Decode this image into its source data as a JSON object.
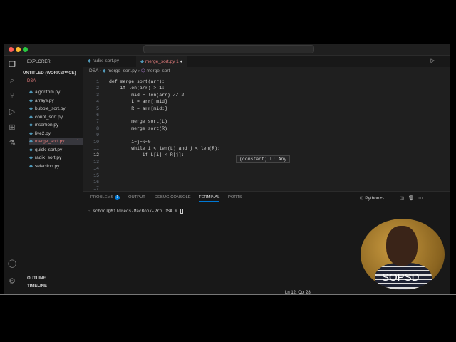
{
  "explorer": {
    "title": "EXPLORER",
    "workspace": "UNTITLED (WORKSPACE)",
    "folder": "DSA",
    "files": [
      {
        "name": "algorithm.py"
      },
      {
        "name": "arrays.py"
      },
      {
        "name": "bubble_sort.py"
      },
      {
        "name": "count_sort.py"
      },
      {
        "name": "insertion.py"
      },
      {
        "name": "live2.py"
      },
      {
        "name": "merge_sort.py",
        "badge": "1"
      },
      {
        "name": "quick_sort.py"
      },
      {
        "name": "radix_sort.py"
      },
      {
        "name": "selection.py"
      }
    ],
    "outline": "OUTLINE",
    "timeline": "TIMELINE",
    "badge": "1"
  },
  "tabs": [
    {
      "label": "radix_sort.py"
    },
    {
      "label": "merge_sort.py 1",
      "dirty": "●"
    }
  ],
  "breadcrumb": {
    "folder": "DSA",
    "file": "merge_sort.py",
    "symbol": "merge_sort"
  },
  "code": [
    "def merge_sort(arr):",
    "    if len(arr) > 1:",
    "        mid = len(arr) // 2",
    "        L = arr[:mid]",
    "        R = arr[mid:]",
    "",
    "        merge_sort(L)",
    "        merge_sort(R)",
    "",
    "        i=j=k=0",
    "        while i < len(L) and j < len(R):",
    "            if L[i] < R[j]:",
    "",
    "",
    "",
    "",
    ""
  ],
  "hover": "(constant) L: Any",
  "panel": {
    "tabs": [
      "PROBLEMS",
      "OUTPUT",
      "DEBUG CONSOLE",
      "TERMINAL",
      "PORTS"
    ],
    "problems_count": "1",
    "active": "TERMINAL",
    "shell": "Python",
    "prompt": "school@Mildreds-MacBook-Pro DSA % "
  },
  "status": {
    "position": "Ln 12, Col 28"
  },
  "webcam": {
    "watermark": "SOPSD"
  }
}
